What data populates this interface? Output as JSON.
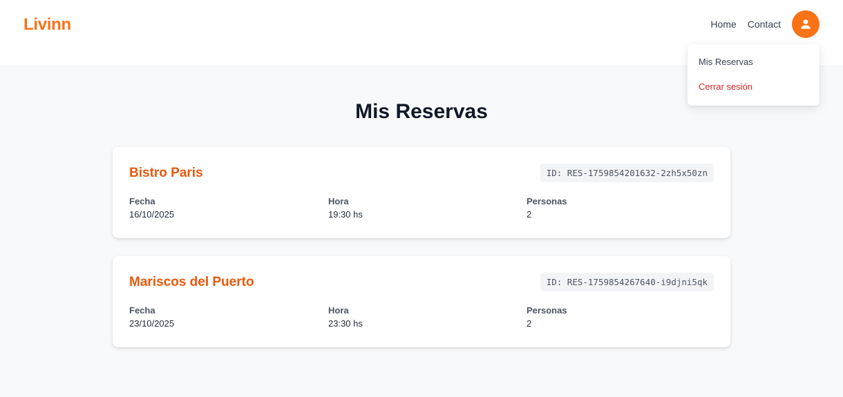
{
  "header": {
    "logo": "Livinn",
    "nav": [
      "Home",
      "Contact"
    ],
    "avatar_icon": "user-icon",
    "accent": "#f97316"
  },
  "dropdown": {
    "items": [
      {
        "label": "Mis Reservas"
      },
      {
        "label": "Cerrar sesión"
      }
    ]
  },
  "main": {
    "title": "Mis Reservas",
    "reservations": [
      {
        "name": "Bistro Paris",
        "id": "ID: RES-1759854201632-2zh5x50zn",
        "fields": [
          {
            "label": "Fecha",
            "value": "16/10/2025"
          },
          {
            "label": "Hora",
            "value": "19:30 hs"
          },
          {
            "label": "Personas",
            "value": "2"
          }
        ]
      },
      {
        "name": "Mariscos del Puerto",
        "id": "ID: RES-1759854267640-i9djni5qk",
        "fields": [
          {
            "label": "Fecha",
            "value": "23/10/2025"
          },
          {
            "label": "Hora",
            "value": "23:30 hs"
          },
          {
            "label": "Personas",
            "value": "2"
          }
        ]
      }
    ]
  }
}
